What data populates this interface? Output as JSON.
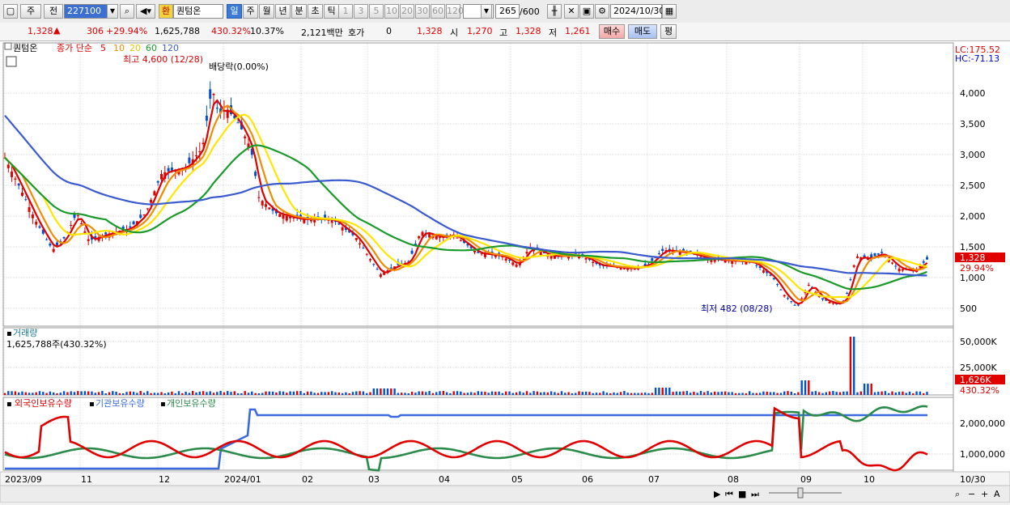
{
  "toolbar": {
    "tab1": "주",
    "tab2": "전",
    "code": "227100",
    "hanja_badge": "환",
    "stock_name": "퀀텀온",
    "periods": [
      "일",
      "주",
      "월",
      "년",
      "분",
      "초",
      "틱"
    ],
    "period_selected": "일",
    "minute_options": [
      "1",
      "3",
      "5",
      "10",
      "20",
      "30",
      "60",
      "120"
    ],
    "count": "265",
    "count_total": "/600",
    "date": "2024/10/30",
    "icons": [
      "panel-icon",
      "search-icon",
      "sound-icon",
      "candle-icon",
      "settings-icon",
      "save-icon",
      "gear-icon"
    ]
  },
  "quote": {
    "price": "1,328",
    "change": "306",
    "change_pct": "+29.94%",
    "volume": "1,625,788",
    "volume_pct": "430.32%",
    "turnover": "10.37%",
    "amount": "2,121백만",
    "hoga_label": "호가",
    "hoga_value": "0",
    "hoga_price": "1,328",
    "open_label": "시",
    "open": "1,270",
    "high_label": "고",
    "high": "1,328",
    "low_label": "저",
    "low": "1,261",
    "buy_label": "매수",
    "sell_label": "매도",
    "eval_label": "평"
  },
  "price_pane": {
    "legend_name": "퀀텀온",
    "legend_type": "종가 단순",
    "ma_periods": [
      "5",
      "10",
      "20",
      "60",
      "120"
    ],
    "high_note": "최고 4,600 (12/28)",
    "dividend_note": "배당락(0.00%)",
    "low_note": "최저 482 (08/28)",
    "lc": "LC:175.52",
    "hc": "HC:-71.13",
    "y_ticks": [
      "4,000",
      "3,500",
      "3,000",
      "2,500",
      "2,000",
      "1,500",
      "1,000",
      "500"
    ],
    "last_price_tag": "1,328",
    "last_pct_tag": "29.94%"
  },
  "volume_pane": {
    "title": "거래량",
    "value": "1,625,788주(430.32%)",
    "y_ticks": [
      "50,000K",
      "25,000K"
    ],
    "last_tag": "1,626K",
    "last_pct": "430.32%"
  },
  "holding_pane": {
    "legend": [
      "외국인보유수량",
      "기관보유수량",
      "개인보유수량"
    ],
    "y_ticks": [
      "2,000,000",
      "1,000,000"
    ]
  },
  "x_axis": [
    "2023/09",
    "11",
    "12",
    "2024/01",
    "02",
    "03",
    "04",
    "05",
    "06",
    "07",
    "08",
    "09",
    "10"
  ],
  "x_end_label": "10/30",
  "colors": {
    "ma5": "#e00000",
    "ma10": "#f08c00",
    "ma20": "#ffe600",
    "ma60": "#1a9a2a",
    "ma120": "#3a5ad0",
    "up": "#e00000",
    "down": "#0050d0",
    "foreign": "#e00000",
    "institution": "#3a6ae0",
    "individual": "#2a8a4a"
  }
}
